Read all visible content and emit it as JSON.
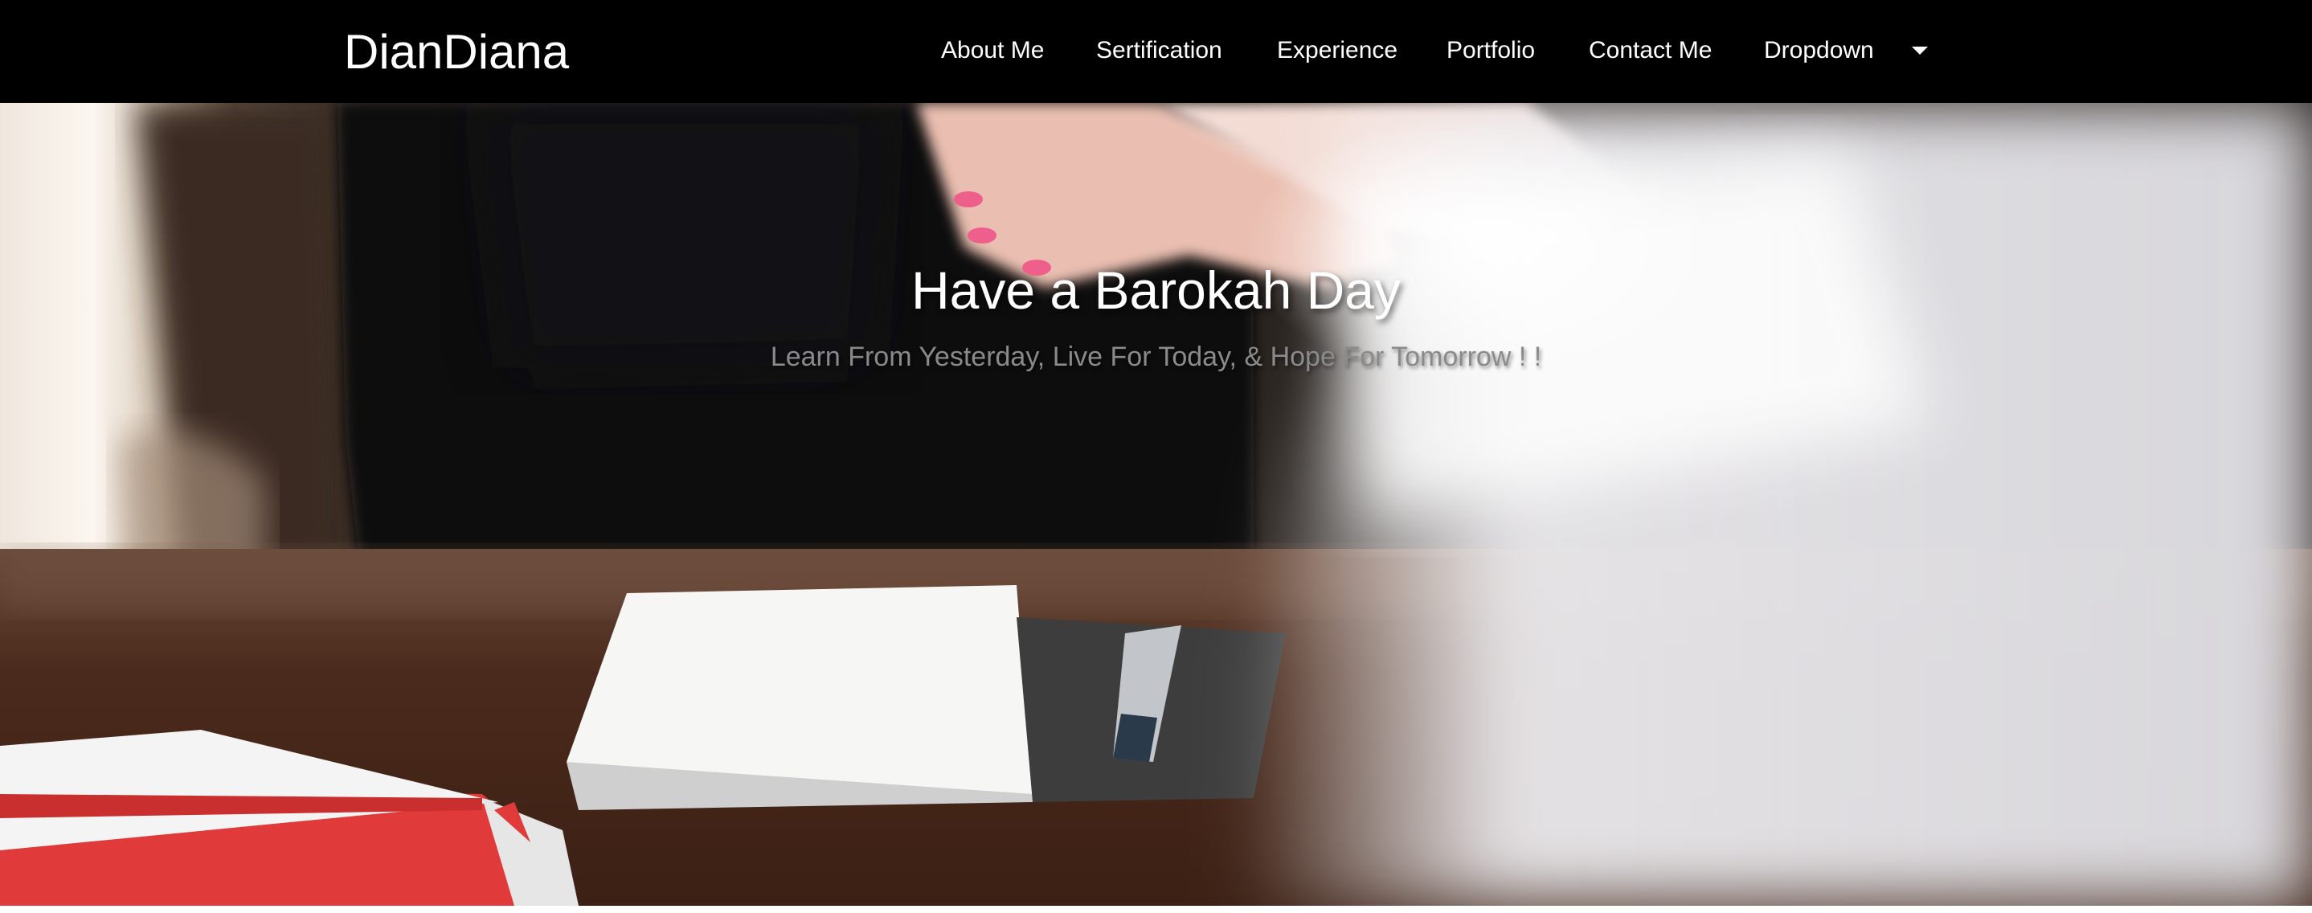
{
  "brand": "DianDiana",
  "nav": {
    "about": "About Me",
    "sertification": "Sertification",
    "experience": "Experience",
    "portfolio": "Portfolio",
    "contact": "Contact Me",
    "dropdown": "Dropdown",
    "dropdown_icon": "caret-down-icon"
  },
  "hero": {
    "title": "Have a Barokah Day",
    "subtitle": "Learn From Yesterday, Live For Today, & Hope For Tomorrow ! !",
    "image": "handshake-over-desk-photo"
  },
  "colors": {
    "navbar_bg": "#000000",
    "nav_text": "#ffffff",
    "hero_title": "#ffffff",
    "hero_subtitle": "#8a8a8a"
  }
}
